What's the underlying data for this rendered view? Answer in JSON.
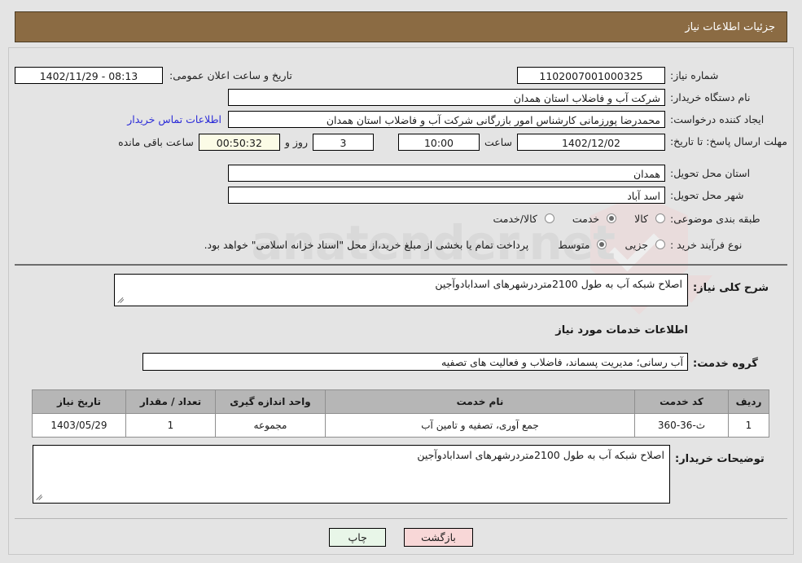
{
  "header": {
    "title": "جزئیات اطلاعات نیاز"
  },
  "watermark": {
    "text": "anatender.net"
  },
  "form": {
    "need_number_label": "شماره نیاز:",
    "need_number_value": "1102007001000325",
    "announce_label": "تاریخ و ساعت اعلان عمومی:",
    "announce_value": "08:13 - 1402/11/29",
    "buyer_org_label": "نام دستگاه خریدار:",
    "buyer_org_value": "شرکت آب و فاضلاب استان همدان",
    "creator_label": "ایجاد کننده درخواست:",
    "creator_value": "محمدرضا پورزمانی کارشناس امور بازرگانی شرکت آب و فاضلاب استان همدان",
    "contact_link": "اطلاعات تماس خریدار",
    "deadline_label": "مهلت ارسال پاسخ: تا تاریخ:",
    "deadline_date": "1402/12/02",
    "deadline_time_label": "ساعت",
    "deadline_time_value": "10:00",
    "remaining_days": "3",
    "remaining_days_label": "روز و",
    "remaining_time": "00:50:32",
    "remaining_suffix_label": "ساعت باقی مانده",
    "province_label": "استان محل تحویل:",
    "province_value": "همدان",
    "city_label": "شهر محل تحویل:",
    "city_value": "اسد آباد",
    "category_label": "طبقه بندی موضوعی:",
    "category_options": [
      {
        "label": "کالا",
        "selected": false
      },
      {
        "label": "خدمت",
        "selected": true
      },
      {
        "label": "کالا/خدمت",
        "selected": false
      }
    ],
    "process_label": "نوع فرآیند خرید :",
    "process_options": [
      {
        "label": "جزیی",
        "selected": false
      },
      {
        "label": "متوسط",
        "selected": true
      }
    ],
    "payment_note": "پرداخت تمام یا بخشی از مبلغ خرید،از محل \"اسناد خزانه اسلامی\" خواهد بود."
  },
  "description": {
    "label": "شرح کلی نیاز:",
    "value": "اصلاح شبکه آب به طول 2100متردرشهرهای اسدابادوآجین"
  },
  "services_section": {
    "heading": "اطلاعات خدمات مورد نیاز",
    "group_label": "گروه خدمت:",
    "group_value": "آب رسانی؛ مدیریت پسماند، فاضلاب و فعالیت های تصفیه"
  },
  "table": {
    "columns": [
      "ردیف",
      "کد خدمت",
      "نام خدمت",
      "واحد اندازه گیری",
      "تعداد / مقدار",
      "تاریخ نیاز"
    ],
    "rows": [
      {
        "index": "1",
        "code": "ث-36-360",
        "name": "جمع آوری، تصفیه و تامین آب",
        "unit": "مجموعه",
        "quantity": "1",
        "need_date": "1403/05/29"
      }
    ]
  },
  "buyer_notes": {
    "label": "توضیحات خریدار:",
    "value": "اصلاح شبکه آب به طول 2100متردرشهرهای اسدابادوآجین"
  },
  "buttons": {
    "print": "چاپ",
    "back": "بازگشت"
  }
}
